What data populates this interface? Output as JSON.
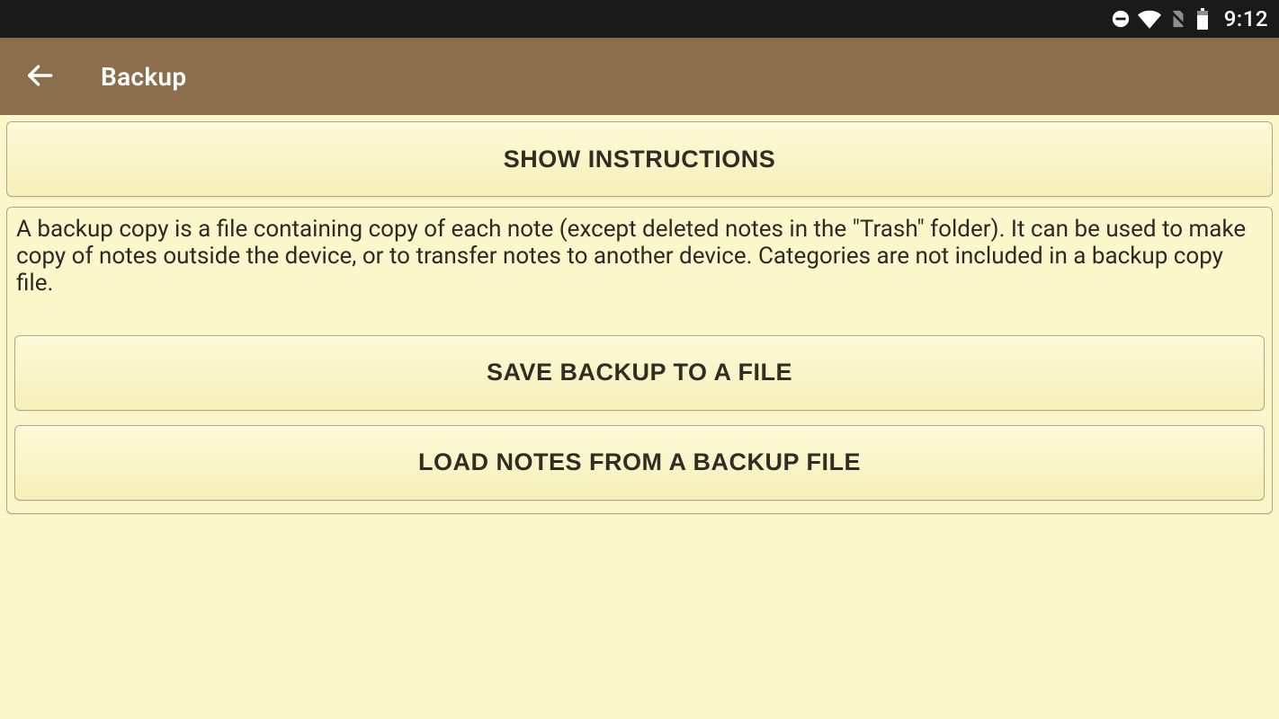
{
  "status": {
    "clock": "9:12"
  },
  "appbar": {
    "title": "Backup"
  },
  "main": {
    "show_instructions_label": "SHOW INSTRUCTIONS",
    "description": "A backup copy is a file containing copy of each note (except deleted notes in the \"Trash\" folder). It can be used to make copy of notes outside the device, or to transfer notes to another device. Categories are not included in a backup copy file.",
    "save_backup_label": "SAVE BACKUP TO A FILE",
    "load_backup_label": "LOAD NOTES FROM A BACKUP FILE"
  },
  "colors": {
    "appbar_bg": "#8b6e4c",
    "page_bg": "#fbf7cb",
    "button_border": "#b2a781"
  }
}
